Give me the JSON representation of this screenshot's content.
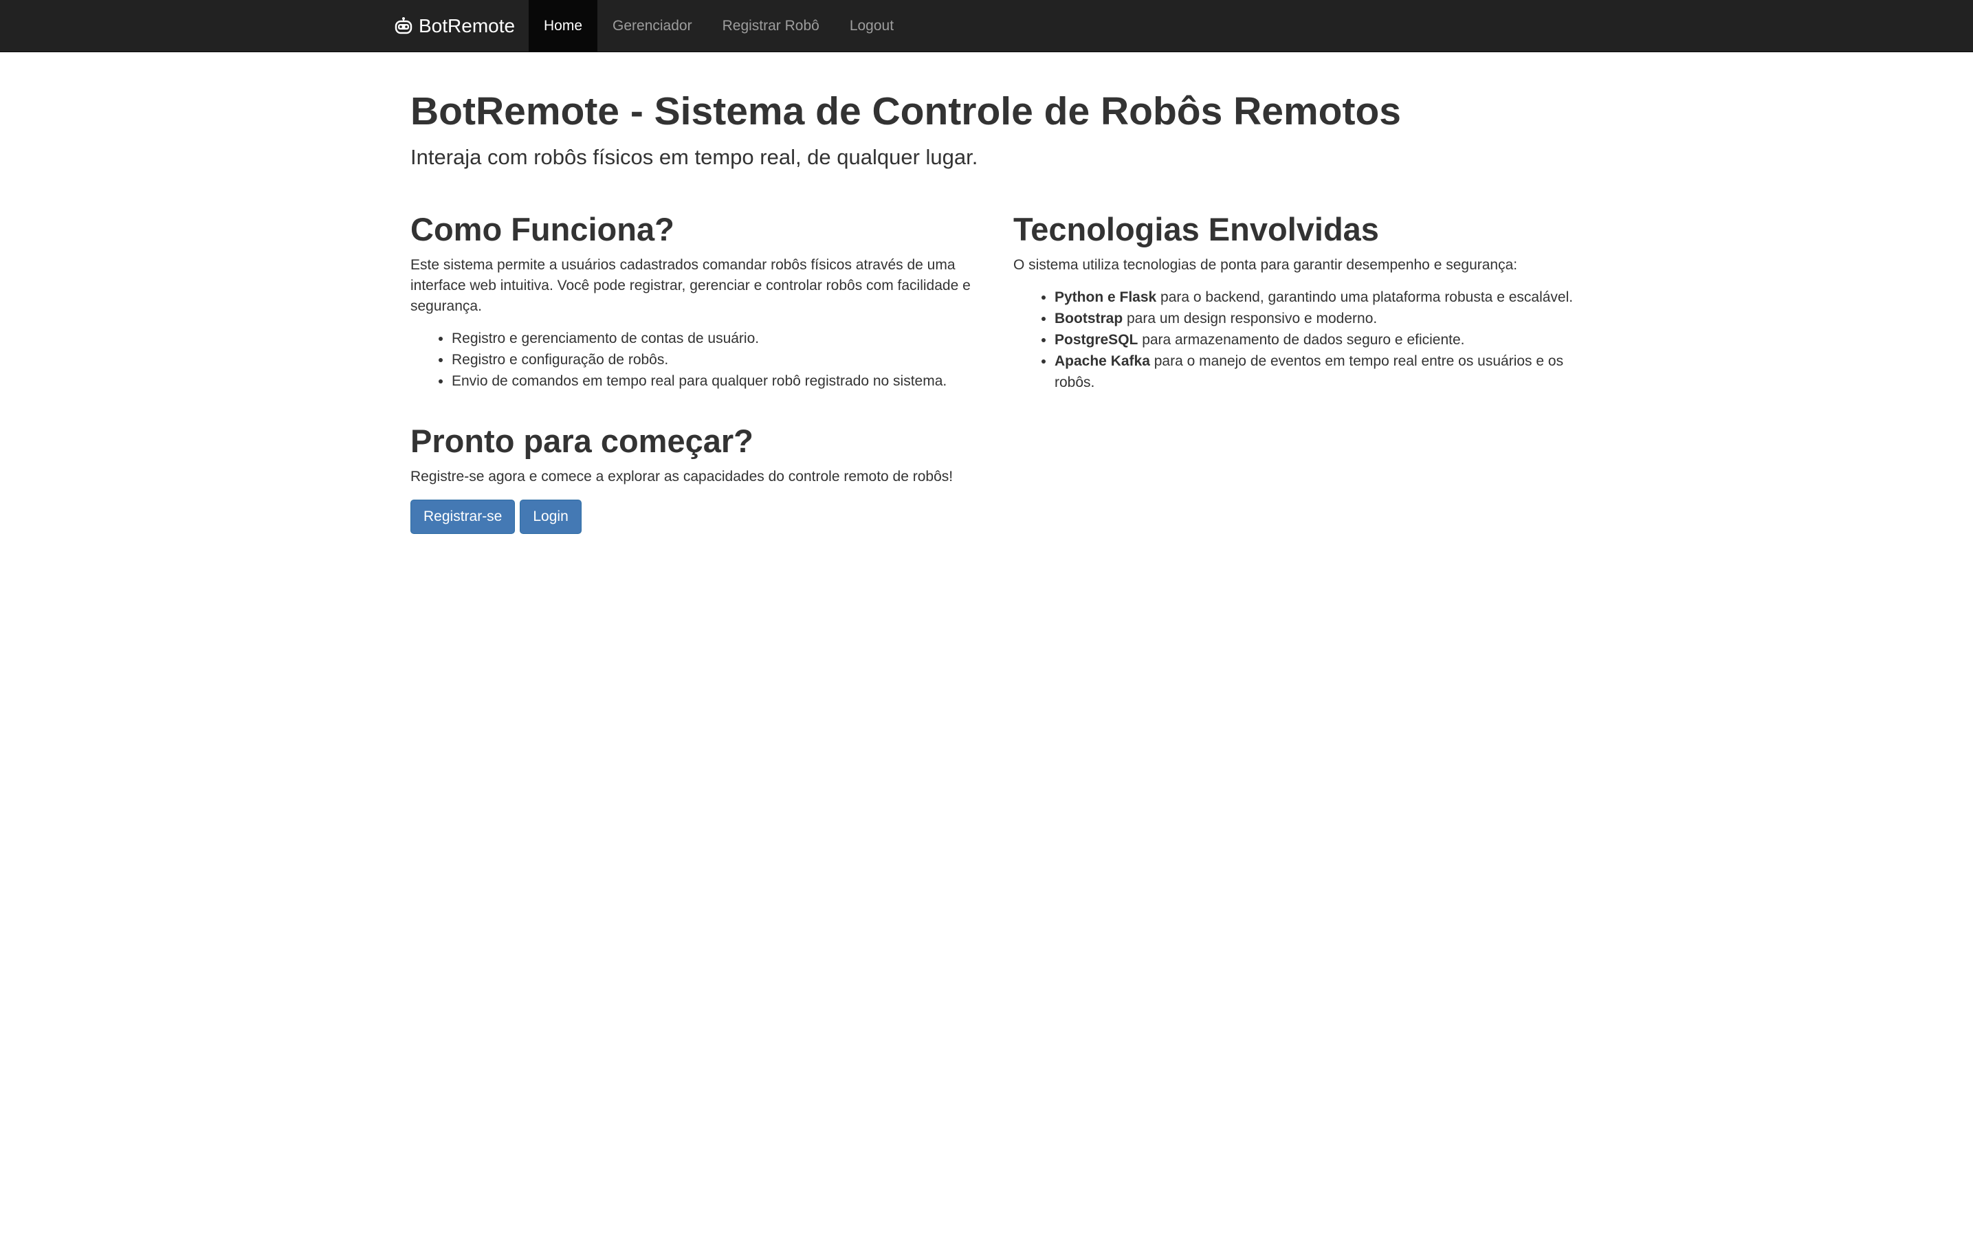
{
  "navbar": {
    "brand": "BotRemote",
    "brand_icon": "robot-icon",
    "items": [
      {
        "label": "Home",
        "active": true
      },
      {
        "label": "Gerenciador",
        "active": false
      },
      {
        "label": "Registrar Robô",
        "active": false
      },
      {
        "label": "Logout",
        "active": false
      }
    ]
  },
  "hero": {
    "title": "BotRemote - Sistema de Controle de Robôs Remotos",
    "subtitle": "Interaja com robôs físicos em tempo real, de qualquer lugar."
  },
  "how_it_works": {
    "heading": "Como Funciona?",
    "description": "Este sistema permite a usuários cadastrados comandar robôs físicos através de uma interface web intuitiva. Você pode registrar, gerenciar e controlar robôs com facilidade e segurança.",
    "items": [
      "Registro e gerenciamento de contas de usuário.",
      "Registro e configuração de robôs.",
      "Envio de comandos em tempo real para qualquer robô registrado no sistema."
    ]
  },
  "technologies": {
    "heading": "Tecnologias Envolvidas",
    "description": "O sistema utiliza tecnologias de ponta para garantir desempenho e segurança:",
    "items": [
      {
        "name": "Python e Flask",
        "text": " para o backend, garantindo uma plataforma robusta e escalável."
      },
      {
        "name": "Bootstrap",
        "text": " para um design responsivo e moderno."
      },
      {
        "name": "PostgreSQL",
        "text": " para armazenamento de dados seguro e eficiente."
      },
      {
        "name": "Apache Kafka",
        "text": " para o manejo de eventos em tempo real entre os usuários e os robôs."
      }
    ]
  },
  "cta": {
    "heading": "Pronto para começar?",
    "description": "Registre-se agora e comece a explorar as capacidades do controle remoto de robôs!",
    "register_label": "Registrar-se",
    "login_label": "Login"
  },
  "colors": {
    "navbar_bg": "#222222",
    "nav_active_bg": "#080808",
    "button_primary": "#4479b4",
    "text": "#333333"
  }
}
